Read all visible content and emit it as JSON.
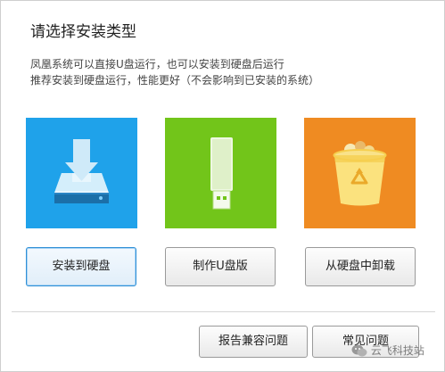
{
  "dialog": {
    "title": "请选择安装类型",
    "description_line1": "凤凰系统可以直接U盘运行，也可以安装到硬盘后运行",
    "description_line2": "推荐安装到硬盘运行，性能更好（不会影响到已安装的系统）"
  },
  "options": [
    {
      "label": "安装到硬盘",
      "icon": "hard-disk-install-icon",
      "color": "#1fa2ea"
    },
    {
      "label": "制作U盘版",
      "icon": "usb-drive-icon",
      "color": "#72c51a"
    },
    {
      "label": "从硬盘中卸载",
      "icon": "recycle-bin-icon",
      "color": "#ef8b22"
    }
  ],
  "footer": {
    "report_button": "报告兼容问题",
    "faq_button": "常见问题"
  },
  "watermark": {
    "text": "云飞科技站"
  }
}
